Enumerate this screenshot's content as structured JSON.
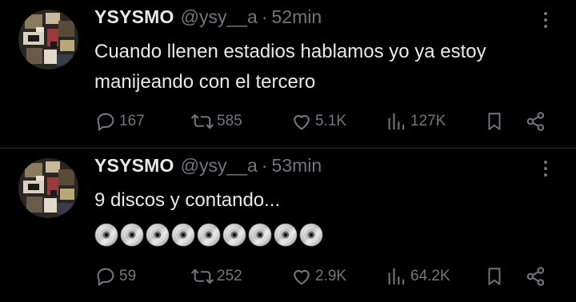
{
  "colors": {
    "background": "#000000",
    "text_primary": "#e7e9ea",
    "text_secondary": "#71767b",
    "divider": "#2f3336"
  },
  "tweets": [
    {
      "display_name": "YSYSMO",
      "handle": "@ysy__a",
      "separator": "·",
      "time": "52min",
      "text": "Cuando llenen estadios hablamos yo ya estoy manijeando con el tercero",
      "emoji_count": 0,
      "stats": {
        "replies": "167",
        "reposts": "585",
        "likes": "5.1K",
        "views": "127K"
      },
      "icons": [
        "reply-icon",
        "repost-icon",
        "like-icon",
        "views-icon",
        "bookmark-icon",
        "share-icon"
      ]
    },
    {
      "display_name": "YSYSMO",
      "handle": "@ysy__a",
      "separator": "·",
      "time": "53min",
      "text": "9 discos y contando...",
      "emoji_count": 9,
      "emoji_name": "optical-disc-emoji",
      "stats": {
        "replies": "59",
        "reposts": "252",
        "likes": "2.9K",
        "views": "64.2K"
      },
      "icons": [
        "reply-icon",
        "repost-icon",
        "like-icon",
        "views-icon",
        "bookmark-icon",
        "share-icon"
      ]
    }
  ]
}
